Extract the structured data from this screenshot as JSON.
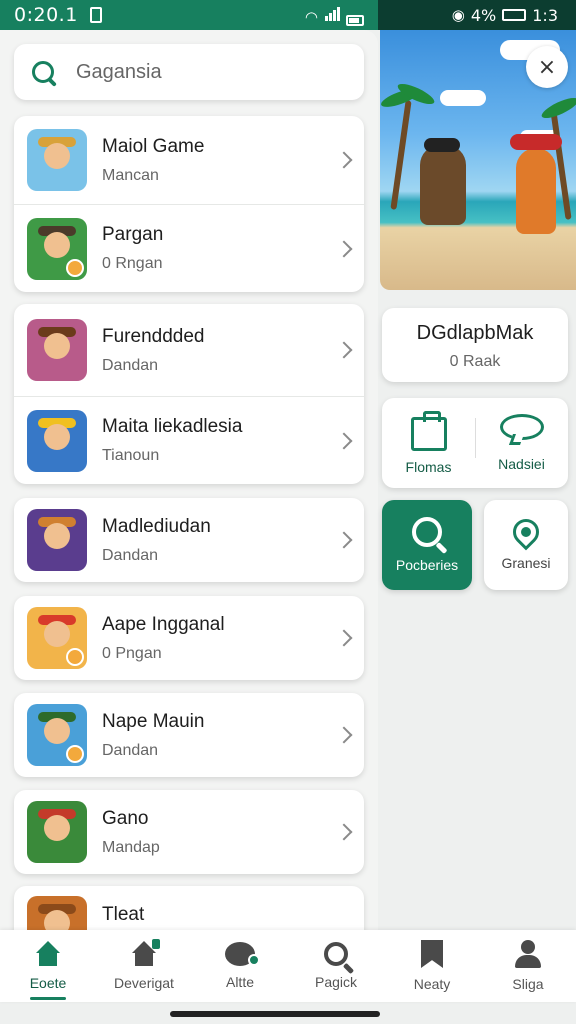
{
  "status": {
    "time": "0:20.1",
    "right_percent": "4%",
    "right_battery_text": "1:3"
  },
  "search": {
    "placeholder": "Gagansia"
  },
  "list": [
    {
      "title": "Maiol Game",
      "subtitle": "Mancan",
      "thumb_color": "#7ac2e8",
      "accent": "#d8a23a",
      "badge": false
    },
    {
      "title": "Pargan",
      "subtitle": "0 Rngan",
      "thumb_color": "#3f9a46",
      "accent": "#4b3a2a",
      "badge": true
    },
    {
      "title": "Furenddded",
      "subtitle": "Dandan",
      "thumb_color": "#b85b8a",
      "accent": "#6b3b1b",
      "badge": false
    },
    {
      "title": "Maita liekadlesia",
      "subtitle": "Tianoun",
      "thumb_color": "#3778c7",
      "accent": "#f0c020",
      "badge": false
    },
    {
      "title": "Madlediudan",
      "subtitle": "Dandan",
      "thumb_color": "#5a3d8e",
      "accent": "#d08030",
      "badge": false
    },
    {
      "title": "Aape Ingganal",
      "subtitle": "0 Pngan",
      "thumb_color": "#f2b44a",
      "accent": "#d83a2a",
      "badge": true
    },
    {
      "title": "Nape Mauin",
      "subtitle": "Dandan",
      "thumb_color": "#4aa0d8",
      "accent": "#2e6b2b",
      "badge": true
    },
    {
      "title": "Gano",
      "subtitle": "Mandap",
      "thumb_color": "#3a8a3a",
      "accent": "#c43a2a",
      "badge": false
    },
    {
      "title": "Tleat",
      "subtitle": "",
      "thumb_color": "#c8702a",
      "accent": "#8b4a1a",
      "badge": false
    }
  ],
  "info_card": {
    "title": "DGdlapbMak",
    "subtitle": "0 Raak"
  },
  "actions": {
    "left_label": "Flomas",
    "right_label": "Nadsiei",
    "primary_label": "Pocberies",
    "secondary_label": "Granesi"
  },
  "nav": [
    {
      "label": "Eoete",
      "icon": "home-icon"
    },
    {
      "label": "Deverigat",
      "icon": "house-badge-icon"
    },
    {
      "label": "Altte",
      "icon": "chat-icon"
    },
    {
      "label": "Pagick",
      "icon": "search-icon"
    },
    {
      "label": "Neaty",
      "icon": "bookmark-icon"
    },
    {
      "label": "Sliga",
      "icon": "person-icon"
    }
  ],
  "close_icon": "×",
  "colors": {
    "accent": "#17805f",
    "dark": "#0c3d30"
  }
}
